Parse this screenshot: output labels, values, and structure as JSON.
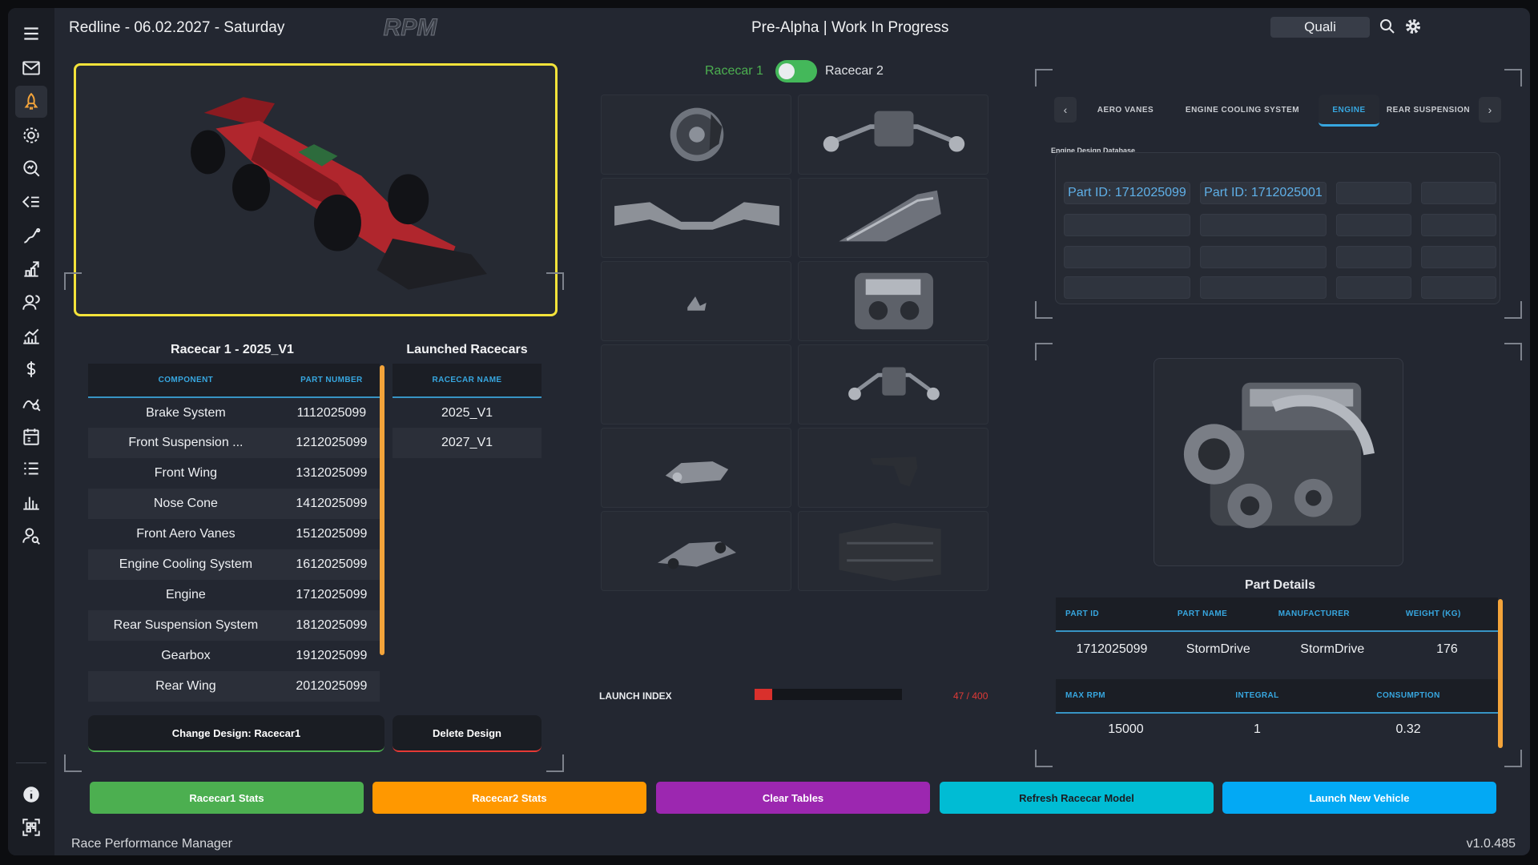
{
  "header": {
    "title": "Redline - 06.02.2027 - Saturday",
    "center_text": "Pre-Alpha | Work In Progress",
    "session_mode": "Quali",
    "logo_text": "RPM"
  },
  "sidebar": {
    "icons": [
      "menu-icon",
      "mail-icon",
      "rocket-icon",
      "gear-icon",
      "search-analytics-icon",
      "list-arrow-icon",
      "route-icon",
      "chart-arrow-icon",
      "users-icon",
      "growth-chart-icon",
      "dollar-icon",
      "curve-analytics-icon",
      "calendar-icon",
      "checklist-icon",
      "bar-chart-icon",
      "user-search-icon",
      "info-icon",
      "qr-scan-icon"
    ],
    "active_index": 2
  },
  "racecar_table": {
    "title": "Racecar 1 - 2025_V1",
    "headers": [
      "COMPONENT",
      "PART NUMBER"
    ],
    "rows": [
      [
        "Brake System",
        "1112025099"
      ],
      [
        "Front Suspension ...",
        "1212025099"
      ],
      [
        "Front Wing",
        "1312025099"
      ],
      [
        "Nose Cone",
        "1412025099"
      ],
      [
        "Front Aero Vanes",
        "1512025099"
      ],
      [
        "Engine Cooling System",
        "1612025099"
      ],
      [
        "Engine",
        "1712025099"
      ],
      [
        "Rear Suspension System",
        "1812025099"
      ],
      [
        "Gearbox",
        "1912025099"
      ],
      [
        "Rear Wing",
        "2012025099"
      ]
    ]
  },
  "launched_table": {
    "title": "Launched Racecars",
    "headers": [
      "RACECAR NAME"
    ],
    "rows": [
      "2025_V1",
      "2027_V1"
    ]
  },
  "actions": {
    "change_design": "Change Design: Racecar1",
    "delete_design": "Delete Design"
  },
  "toggle": {
    "left_label": "Racecar 1",
    "right_label": "Racecar 2"
  },
  "launch_index": {
    "label": "LAUNCH INDEX",
    "value": 47,
    "max": 400,
    "display": "47 / 400"
  },
  "tabs": {
    "items": [
      "AERO VANES",
      "ENGINE COOLING SYSTEM",
      "ENGINE",
      "REAR SUSPENSION"
    ],
    "active": "ENGINE"
  },
  "database": {
    "label": "Engine Design Database",
    "part_ids": [
      "Part ID: 1712025099",
      "Part ID: 1712025001"
    ]
  },
  "part_details": {
    "title": "Part Details",
    "headers1": [
      "PART ID",
      "PART NAME",
      "MANUFACTURER",
      "WEIGHT (KG)"
    ],
    "row1": [
      "1712025099",
      "StormDrive",
      "StormDrive",
      "176"
    ],
    "headers2": [
      "MAX RPM",
      "INTEGRAL",
      "CONSUMPTION"
    ],
    "row2": [
      "15000",
      "1",
      "0.32"
    ]
  },
  "bottom_buttons": [
    {
      "label": "Racecar1 Stats",
      "color": "#4caf50"
    },
    {
      "label": "Racecar2 Stats",
      "color": "#ff9800"
    },
    {
      "label": "Clear Tables",
      "color": "#9c27b0"
    },
    {
      "label": "Refresh Racecar Model",
      "color": "#00bcd4"
    },
    {
      "label": "Launch New Vehicle",
      "color": "#03a9f4"
    }
  ],
  "footer": {
    "app_name": "Race Performance Manager",
    "version": "v1.0.485"
  },
  "colors": {
    "accent_blue": "#37a7e0",
    "highlight_yellow": "#f4e33a",
    "scrollbar_orange": "#f4a43a",
    "toggle_green": "#44b85a"
  }
}
